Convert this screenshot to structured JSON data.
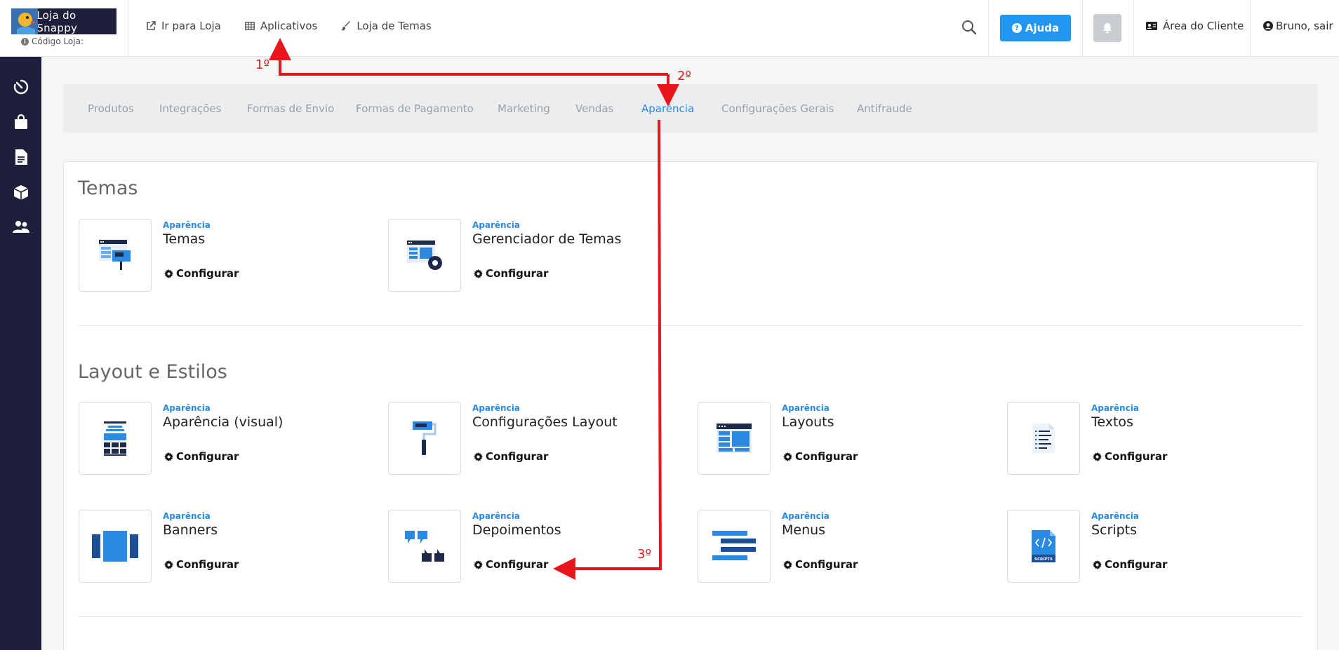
{
  "header": {
    "logo_text": "Loja do Snappy",
    "store_code_label": "Código Loja:",
    "nav": [
      {
        "label": "Ir para Loja",
        "icon": "external-link-icon"
      },
      {
        "label": "Aplicativos",
        "icon": "grid-table-icon"
      },
      {
        "label": "Loja de Temas",
        "icon": "brush-icon"
      }
    ],
    "help_label": "Ajuda",
    "client_area_label": "Área do Cliente",
    "user_label": "Bruno, sair"
  },
  "sidebar": {
    "icons": [
      "speed-dial-icon",
      "shopping-bag-icon",
      "document-icon",
      "box-icon",
      "users-icon"
    ]
  },
  "tabs": [
    {
      "label": "Produtos",
      "active": false
    },
    {
      "label": "Integrações",
      "active": false
    },
    {
      "label": "Formas de Envio",
      "active": false
    },
    {
      "label": "Formas de Pagamento",
      "active": false
    },
    {
      "label": "Marketing",
      "active": false
    },
    {
      "label": "Vendas",
      "active": false
    },
    {
      "label": "Aparência",
      "active": true
    },
    {
      "label": "Configurações Gerais",
      "active": false
    },
    {
      "label": "Antifraude",
      "active": false
    }
  ],
  "sections": [
    {
      "title": "Temas",
      "apps": [
        {
          "category": "Aparência",
          "name": "Temas",
          "action": "Configurar"
        },
        {
          "category": "Aparência",
          "name": "Gerenciador de Temas",
          "action": "Configurar"
        }
      ]
    },
    {
      "title": "Layout e Estilos",
      "apps": [
        {
          "category": "Aparência",
          "name": "Aparência (visual)",
          "action": "Configurar"
        },
        {
          "category": "Aparência",
          "name": "Configurações Layout",
          "action": "Configurar"
        },
        {
          "category": "Aparência",
          "name": "Layouts",
          "action": "Configurar"
        },
        {
          "category": "Aparência",
          "name": "Textos",
          "action": "Configurar"
        },
        {
          "category": "Aparência",
          "name": "Banners",
          "action": "Configurar"
        },
        {
          "category": "Aparência",
          "name": "Depoimentos",
          "action": "Configurar"
        },
        {
          "category": "Aparência",
          "name": "Menus",
          "action": "Configurar"
        },
        {
          "category": "Aparência",
          "name": "Scripts",
          "action": "Configurar"
        }
      ]
    }
  ],
  "annotations": {
    "step1": "1º",
    "step2": "2º",
    "step3": "3º",
    "arrow_color": "#e8161d"
  },
  "colors": {
    "sidebar": "#1e1f3a",
    "accent": "#2196f3",
    "active_tab": "#2a8ae2"
  }
}
